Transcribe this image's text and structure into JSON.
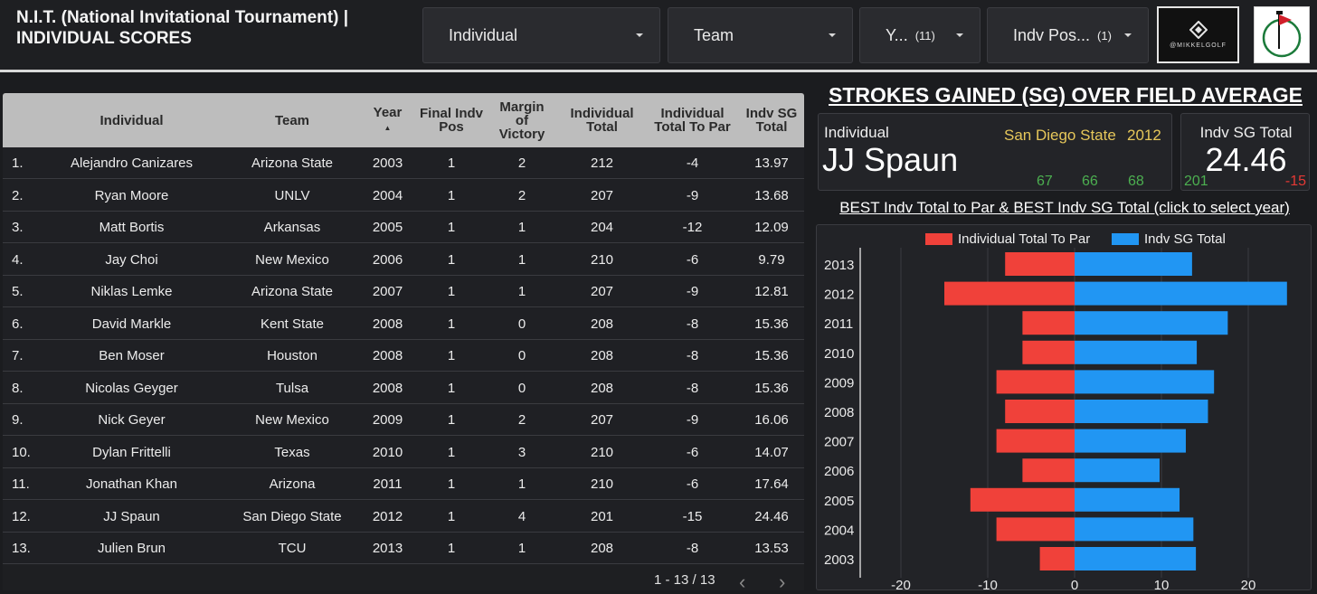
{
  "header": {
    "title": "N.I.T. (National Invitational Tournament) | INDIVIDUAL SCORES",
    "filters": [
      {
        "label": "Individual",
        "count": ""
      },
      {
        "label": "Team",
        "count": ""
      },
      {
        "label": "Y...",
        "count": "(11)"
      },
      {
        "label": "Indv Pos...",
        "count": "(1)"
      }
    ],
    "logo_text": "@MIKKELGOLF"
  },
  "table": {
    "headers": {
      "individual": "Individual",
      "team": "Team",
      "year": "Year",
      "final_pos": "Final Indv Pos",
      "margin": "Margin of Victory",
      "total": "Individual Total",
      "to_par": "Individual Total To Par",
      "sg": "Indv SG Total"
    },
    "rows": [
      {
        "n": "1.",
        "individual": "Alejandro Canizares",
        "team": "Arizona State",
        "year": "2003",
        "pos": "1",
        "margin": "2",
        "total": "212",
        "to_par": "-4",
        "sg": "13.97"
      },
      {
        "n": "2.",
        "individual": "Ryan Moore",
        "team": "UNLV",
        "year": "2004",
        "pos": "1",
        "margin": "2",
        "total": "207",
        "to_par": "-9",
        "sg": "13.68"
      },
      {
        "n": "3.",
        "individual": "Matt Bortis",
        "team": "Arkansas",
        "year": "2005",
        "pos": "1",
        "margin": "1",
        "total": "204",
        "to_par": "-12",
        "sg": "12.09"
      },
      {
        "n": "4.",
        "individual": "Jay Choi",
        "team": "New Mexico",
        "year": "2006",
        "pos": "1",
        "margin": "1",
        "total": "210",
        "to_par": "-6",
        "sg": "9.79"
      },
      {
        "n": "5.",
        "individual": "Niklas Lemke",
        "team": "Arizona State",
        "year": "2007",
        "pos": "1",
        "margin": "1",
        "total": "207",
        "to_par": "-9",
        "sg": "12.81"
      },
      {
        "n": "6.",
        "individual": "David Markle",
        "team": "Kent State",
        "year": "2008",
        "pos": "1",
        "margin": "0",
        "total": "208",
        "to_par": "-8",
        "sg": "15.36"
      },
      {
        "n": "7.",
        "individual": "Ben Moser",
        "team": "Houston",
        "year": "2008",
        "pos": "1",
        "margin": "0",
        "total": "208",
        "to_par": "-8",
        "sg": "15.36"
      },
      {
        "n": "8.",
        "individual": "Nicolas Geyger",
        "team": "Tulsa",
        "year": "2008",
        "pos": "1",
        "margin": "0",
        "total": "208",
        "to_par": "-8",
        "sg": "15.36"
      },
      {
        "n": "9.",
        "individual": "Nick Geyer",
        "team": "New Mexico",
        "year": "2009",
        "pos": "1",
        "margin": "2",
        "total": "207",
        "to_par": "-9",
        "sg": "16.06"
      },
      {
        "n": "10.",
        "individual": "Dylan Frittelli",
        "team": "Texas",
        "year": "2010",
        "pos": "1",
        "margin": "3",
        "total": "210",
        "to_par": "-6",
        "sg": "14.07"
      },
      {
        "n": "11.",
        "individual": "Jonathan Khan",
        "team": "Arizona",
        "year": "2011",
        "pos": "1",
        "margin": "1",
        "total": "210",
        "to_par": "-6",
        "sg": "17.64"
      },
      {
        "n": "12.",
        "individual": "JJ Spaun",
        "team": "San Diego State",
        "year": "2012",
        "pos": "1",
        "margin": "4",
        "total": "201",
        "to_par": "-15",
        "sg": "24.46"
      },
      {
        "n": "13.",
        "individual": "Julien Brun",
        "team": "TCU",
        "year": "2013",
        "pos": "1",
        "margin": "1",
        "total": "208",
        "to_par": "-8",
        "sg": "13.53"
      }
    ],
    "pager": "1 - 13 / 13"
  },
  "sg_title": "STROKES GAINED (SG) OVER FIELD AVERAGE",
  "card_individual": {
    "label": "Individual",
    "name": "JJ Spaun",
    "team": "San Diego State",
    "year": "2012",
    "rounds": [
      "67",
      "66",
      "68"
    ]
  },
  "card_sg": {
    "label": "Indv SG Total",
    "value": "24.46",
    "total": "201",
    "to_par": "-15"
  },
  "best_title": "BEST Indv Total to Par & BEST Indv SG Total (click to select year)",
  "colors": {
    "to_par": "#f0413a",
    "sg": "#2196f3"
  },
  "chart_data": {
    "type": "bar",
    "orientation": "horizontal",
    "categories": [
      "2013",
      "2012",
      "2011",
      "2010",
      "2009",
      "2008",
      "2007",
      "2006",
      "2005",
      "2004",
      "2003"
    ],
    "series": [
      {
        "name": "Individual Total To Par",
        "values": [
          -8,
          -15,
          -6,
          -6,
          -9,
          -8,
          -9,
          -6,
          -12,
          -9,
          -4
        ]
      },
      {
        "name": "Indv SG Total",
        "values": [
          13.53,
          24.46,
          17.64,
          14.07,
          16.06,
          15.36,
          12.81,
          9.79,
          12.09,
          13.68,
          13.97
        ]
      }
    ],
    "ticks": [
      "-20",
      "-10",
      "0",
      "10",
      "20"
    ],
    "xlim": [
      -20,
      20
    ],
    "legend": "top"
  }
}
